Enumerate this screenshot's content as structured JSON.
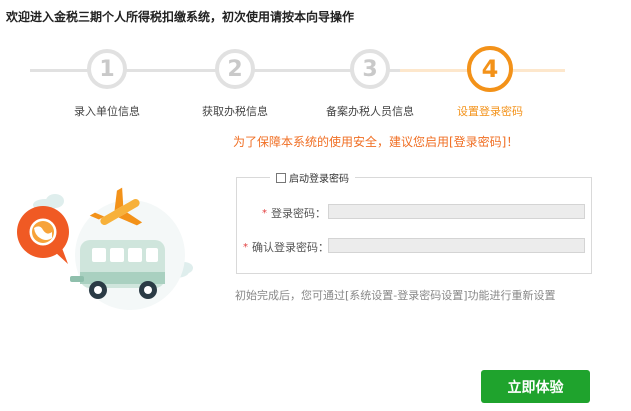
{
  "header": {
    "title": "欢迎进入金税三期个人所得税扣缴系统，初次使用请按本向导操作"
  },
  "steps": [
    {
      "number": "1",
      "label": "录入单位信息",
      "state": "done"
    },
    {
      "number": "2",
      "label": "获取办税信息",
      "state": "done"
    },
    {
      "number": "3",
      "label": "备案办税人员信息",
      "state": "done"
    },
    {
      "number": "4",
      "label": "设置登录密码",
      "state": "active"
    }
  ],
  "colors": {
    "accent": "#f39219",
    "notice": "#f06f24",
    "button": "#1fa32d",
    "inactive": "#e1e1e1"
  },
  "notice": "为了保障本系统的使用安全，建议您启用[登录密码]！",
  "form": {
    "enable_label": "启动登录密码",
    "enable_checked": false,
    "password_label": "登录密码：",
    "confirm_label": "确认登录密码：",
    "password_value": "",
    "confirm_value": ""
  },
  "hint": "初始完成后，您可通过[系统设置-登录密码设置]功能进行重新设置",
  "start_button": "立即体验",
  "illustration": {
    "icons": [
      "globe-bubble-icon",
      "airplane-icon",
      "bus-icon",
      "cloud-icon"
    ]
  }
}
